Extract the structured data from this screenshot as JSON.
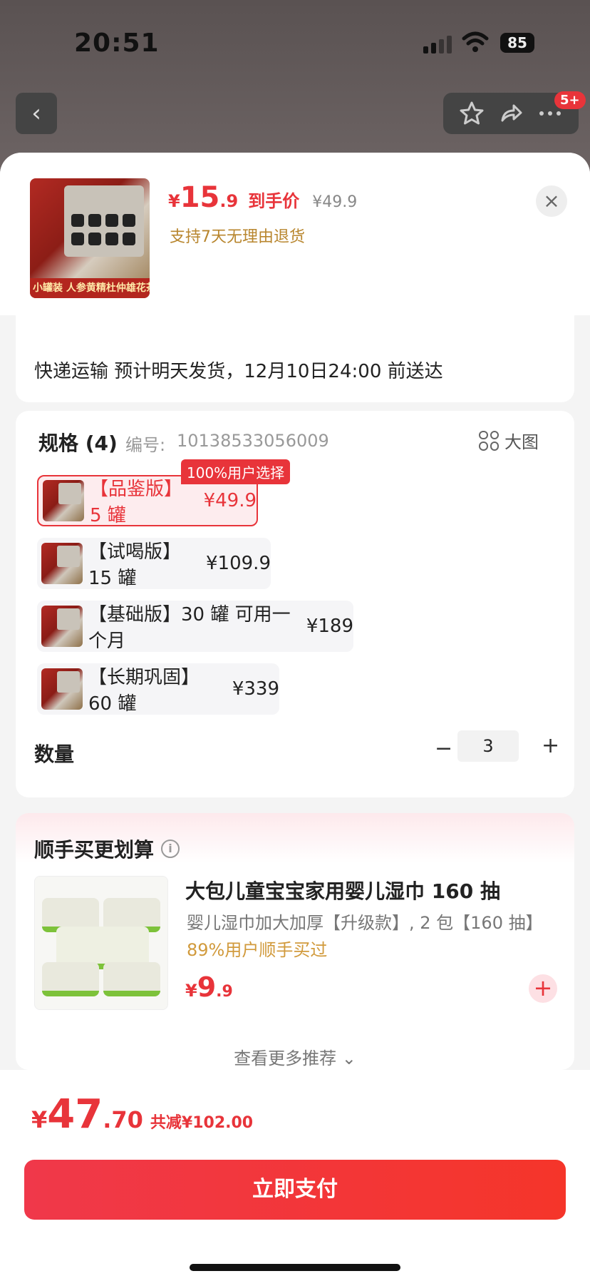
{
  "status_bar": {
    "time": "20:51",
    "battery": "85"
  },
  "nav": {
    "badge": "5+"
  },
  "sheet": {
    "price_yen": "¥",
    "price_int": "15",
    "price_dec": ".9",
    "price_label": "到手价",
    "original_price": "¥49.9",
    "return_policy": "支持7天无理由退货",
    "thumb_banner": "小罐装 人参黄精杜仲雄花茶"
  },
  "delivery": {
    "text": "快递运输 预计明天发货，12月10日24:00 前送达"
  },
  "spec": {
    "title": "规格 (4)",
    "code_label": "编号:",
    "code": "10138533056009",
    "big_image_label": "大图",
    "hot_tag": "100%用户选择",
    "options": [
      {
        "name": "【品鉴版】5 罐",
        "price": "¥49.9"
      },
      {
        "name": "【试喝版】15 罐",
        "price": "¥109.9"
      },
      {
        "name": "【基础版】30 罐 可用一个月",
        "price": "¥189"
      },
      {
        "name": "【长期巩固】60 罐",
        "price": "¥339"
      }
    ],
    "selected_index": 0,
    "quantity_label": "数量",
    "quantity": "3",
    "minus": "−",
    "plus": "+"
  },
  "recommend": {
    "title": "顺手买更划算",
    "name": "大包儿童宝宝家用婴儿湿巾 160 抽",
    "desc": "婴儿湿巾加大加厚【升级款】, 2 包【160 抽】",
    "buy_rate": "89%用户顺手买过",
    "price_yen": "¥",
    "price_int": "9",
    "price_dec": ".9",
    "add": "+",
    "see_more": "查看更多推荐 ⌄"
  },
  "footer": {
    "total_yen": "¥",
    "total_int": "47",
    "total_dec": ".70",
    "discount": "共减¥102.00",
    "pay_label": "立即支付"
  },
  "colors": {
    "accent": "#e8343a",
    "gold": "#b8862e"
  }
}
